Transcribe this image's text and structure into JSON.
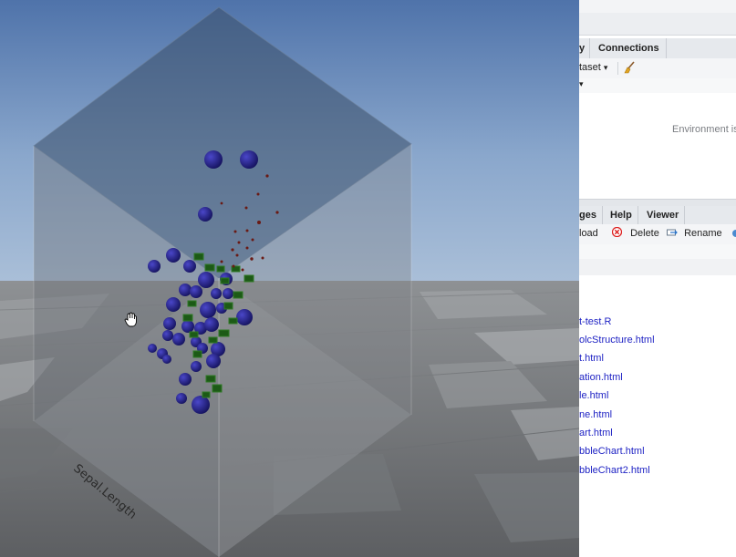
{
  "scene": {
    "cursor": "hand-grab-icon",
    "axis_label": "Sepal.Length",
    "colors": {
      "sky_top": "#4f73aa",
      "sky_bottom": "#9fb8d6",
      "sphere": "#1e1c8a",
      "cube": "#1c5a16",
      "point": "#6a1a14"
    }
  },
  "env_pane": {
    "tabs": [
      {
        "label": "y"
      },
      {
        "label": "Connections"
      }
    ],
    "import_label": "taset",
    "dropdown_caret": "▾",
    "broom_icon": "broom-icon",
    "empty_message": "Environment is"
  },
  "files_pane": {
    "tabs": [
      {
        "label": "ges"
      },
      {
        "label": "Help"
      },
      {
        "label": "Viewer"
      }
    ],
    "upload_label": "load",
    "delete_label": "Delete",
    "rename_label": "Rename",
    "files": [
      {
        "name": "t-test.R"
      },
      {
        "name": "olcStructure.html"
      },
      {
        "name": "t.html"
      },
      {
        "name": "ation.html"
      },
      {
        "name": "le.html"
      },
      {
        "name": "ne.html"
      },
      {
        "name": "art.html"
      },
      {
        "name": "bbleChart.html"
      },
      {
        "name": "bbleChart2.html"
      }
    ]
  }
}
